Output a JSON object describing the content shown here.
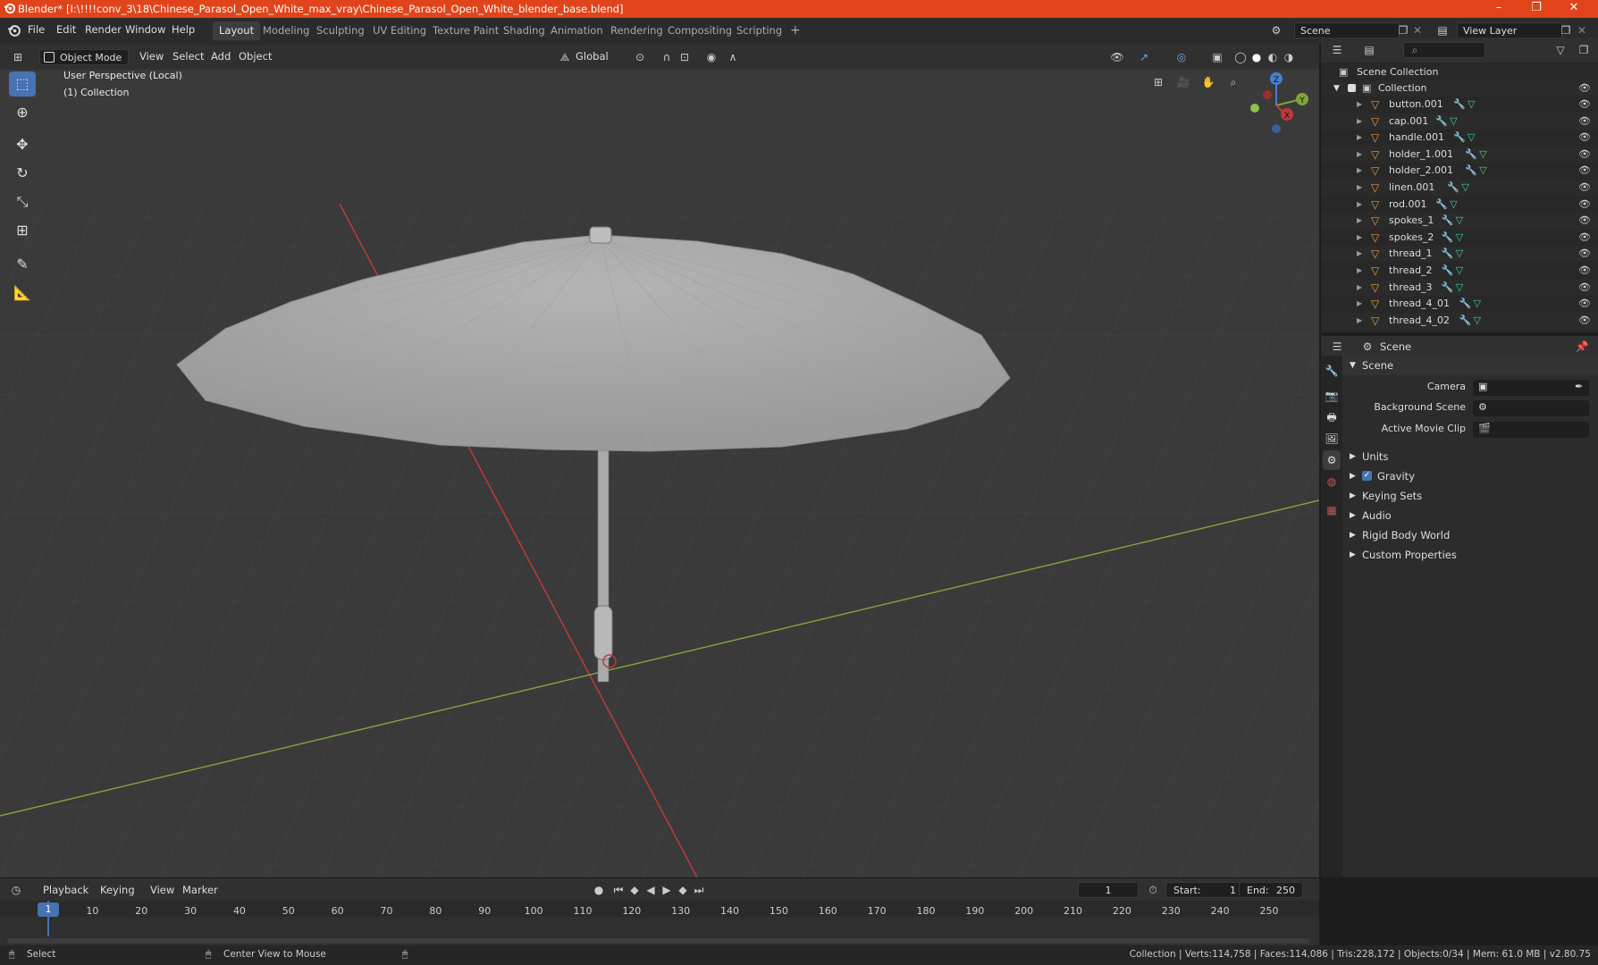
{
  "window": {
    "title": "Blender* [I:\\!!!!conv_3\\18\\Chinese_Parasol_Open_White_max_vray\\Chinese_Parasol_Open_White_blender_base.blend]",
    "minimize": "–",
    "maximize": "❐",
    "close": "✕"
  },
  "menu": [
    "File",
    "Edit",
    "Render",
    "Window",
    "Help"
  ],
  "workspaces": [
    "Layout",
    "Modeling",
    "Sculpting",
    "UV Editing",
    "Texture Paint",
    "Shading",
    "Animation",
    "Rendering",
    "Compositing",
    "Scripting"
  ],
  "workspace_add": "+",
  "scene_field": "Scene",
  "view_layer_field": "View Layer",
  "viewport_header": {
    "mode": "Object Mode",
    "menus": [
      "View",
      "Select",
      "Add",
      "Object"
    ],
    "transform_orientation": "Global"
  },
  "viewport": {
    "perspective_label": "User Perspective (Local)",
    "collection_label": "(1) Collection",
    "gizmo_axes": [
      "Z",
      "Y",
      "X"
    ]
  },
  "outliner": {
    "scene_collection": "Scene Collection",
    "collection": "Collection",
    "objects": [
      "button.001",
      "cap.001",
      "handle.001",
      "holder_1.001",
      "holder_2.001",
      "linen.001",
      "rod.001",
      "spokes_1",
      "spokes_2",
      "thread_1",
      "thread_2",
      "thread_3",
      "thread_4_01",
      "thread_4_02"
    ]
  },
  "properties": {
    "header": "Scene",
    "panel_title": "Scene",
    "fields": [
      {
        "label": "Camera"
      },
      {
        "label": "Background Scene"
      },
      {
        "label": "Active Movie Clip"
      }
    ],
    "subpanels": [
      "Units",
      "Gravity",
      "Keying Sets",
      "Audio",
      "Rigid Body World",
      "Custom Properties"
    ],
    "gravity_checked": true
  },
  "timeline": {
    "menus": [
      "Playback",
      "Keying",
      "View",
      "Marker"
    ],
    "current_frame": "1",
    "start_label": "Start:",
    "start": "1",
    "end_label": "End:",
    "end": "250",
    "ticks": [
      "1",
      "10",
      "20",
      "30",
      "40",
      "50",
      "60",
      "70",
      "80",
      "90",
      "100",
      "110",
      "120",
      "130",
      "140",
      "150",
      "160",
      "170",
      "180",
      "190",
      "200",
      "210",
      "220",
      "230",
      "240",
      "250"
    ]
  },
  "status": {
    "select": "Select",
    "center_view": "Center View to Mouse",
    "stats": "Collection | Verts:114,758 | Faces:114,086 | Tris:228,172 | Objects:0/34 | Mem: 61.0 MB | v2.80.75"
  },
  "colors": {
    "title_bar": "#e1441a",
    "accent": "#4772b3",
    "x_axis": "#c0393b",
    "y_axis": "#7fa33a",
    "object_icon": "#e89a3c",
    "mesh_icon": "#3fd0a0"
  }
}
